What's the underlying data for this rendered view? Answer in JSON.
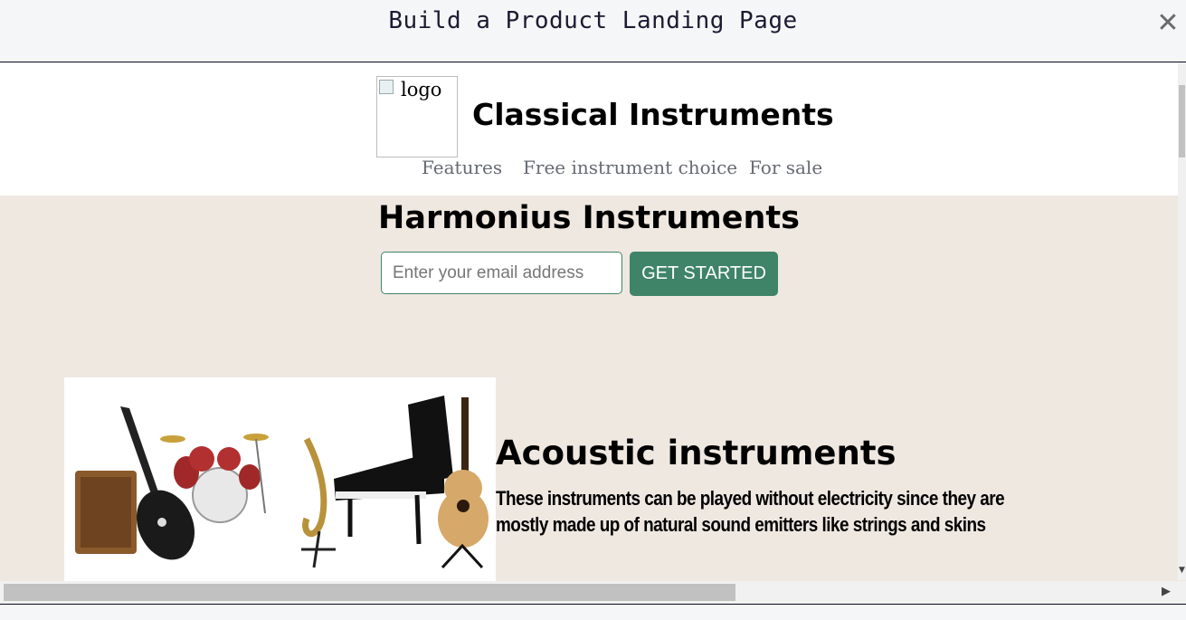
{
  "window": {
    "title": "Build a Product Landing Page",
    "close_glyph": "✕"
  },
  "header": {
    "logo_alt": "logo",
    "site_title": "Classical Instruments",
    "nav": [
      {
        "label": "Features"
      },
      {
        "label": "Free instrument choice"
      },
      {
        "label": "For sale"
      }
    ]
  },
  "hero": {
    "title": "Harmonius Instruments",
    "email_placeholder": "Enter your email address",
    "button_label": "GET STARTED"
  },
  "feature": {
    "image_icon": "musical-instruments-image",
    "title": "Acoustic instruments",
    "text": "These instruments can be played without electricity since they are mostly made up of natural sound emitters like strings and skins"
  },
  "colors": {
    "accent": "#3f8468",
    "page_background": "#efe8e1",
    "header_background": "#ffffff",
    "nav_text": "#666a72"
  }
}
